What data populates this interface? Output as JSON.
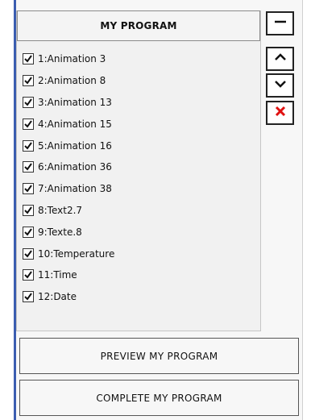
{
  "program": {
    "title": "MY PROGRAM",
    "items": [
      {
        "label": "1:Animation 3",
        "checked": true
      },
      {
        "label": "2:Animation 8",
        "checked": true
      },
      {
        "label": "3:Animation 13",
        "checked": true
      },
      {
        "label": "4:Animation 15",
        "checked": true
      },
      {
        "label": "5:Animation 16",
        "checked": true
      },
      {
        "label": "6:Animation 36",
        "checked": true
      },
      {
        "label": "7:Animation 38",
        "checked": true
      },
      {
        "label": "8:Text2.7",
        "checked": true
      },
      {
        "label": "9:Texte.8",
        "checked": true
      },
      {
        "label": "10:Temperature",
        "checked": true
      },
      {
        "label": "11:Time",
        "checked": true
      },
      {
        "label": "12:Date",
        "checked": true
      }
    ]
  },
  "side_buttons": {
    "icons": [
      "minus-icon",
      "chevron-up-icon",
      "chevron-down-icon",
      "close-icon"
    ],
    "delete_color": "#e01010"
  },
  "actions": {
    "preview_label": "PREVIEW MY PROGRAM",
    "complete_label": "COMPLETE MY PROGRAM"
  }
}
